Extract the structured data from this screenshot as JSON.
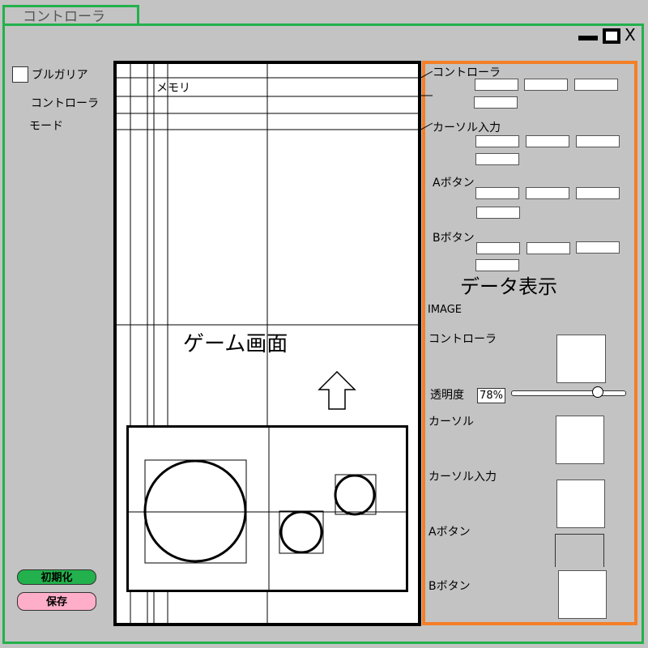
{
  "window": {
    "tab_title": "コントローラ",
    "minimize": "▬",
    "maximize": "■",
    "close": "X"
  },
  "left": {
    "checkbox_label": "ブルガリア",
    "controller_label": "コントローラ",
    "mode_label": "モード",
    "reset_button": "初期化",
    "save_button": "保存",
    "reset_color": "#22b14c",
    "save_color": "#ffaec9"
  },
  "game": {
    "memory_label": "メモリ",
    "screen_label": "ゲーム画面"
  },
  "panel": {
    "controller_label": "コントローラ",
    "cursor_input_label": "カーソル入力",
    "a_button_label": "Aボタン",
    "b_button_label": "Bボタン",
    "data_display_label": "データ表示",
    "image_label": "IMAGE",
    "img_controller_label": "コントローラ",
    "opacity_label": "透明度",
    "opacity_value": "78%",
    "opacity_level": 0.78,
    "img_cursor_label": "カーソル",
    "img_cursor_input_label": "カーソル入力",
    "img_a_button_label": "Aボタン",
    "img_b_button_label": "Bボタン"
  },
  "colors": {
    "frame_green": "#22b14c",
    "panel_orange": "#f47f27",
    "background": "#c3c3c3"
  }
}
